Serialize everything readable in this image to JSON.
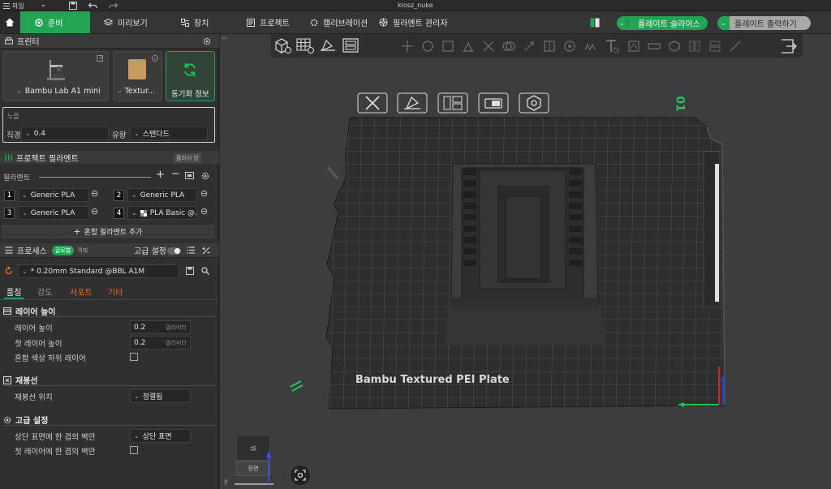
{
  "titlebar": {
    "file_menu": "파일",
    "title": "klosz_nuke"
  },
  "tabs": {
    "prepare": "준비",
    "preview": "미리보기",
    "device": "장치",
    "project": "프로젝트",
    "calibration": "캘리브레이션",
    "filament_manager": "필라멘트 관리자"
  },
  "actions": {
    "slice_plate": "플레이트 슬라이스",
    "print_plate": "플레이트 출력하기"
  },
  "printer": {
    "section_title": "프린터",
    "printer_name": "Bambu Lab A1 mini",
    "plate_name": "Textur...",
    "sync_label": "동기화 정보"
  },
  "nozzle": {
    "title": "노즐",
    "diameter_label": "직경",
    "diameter_value": "0.4",
    "flow_label": "유량",
    "flow_value": "스탠다드"
  },
  "project_filament": {
    "title": "프로젝트 필라멘트",
    "flush_badge": "플러시 양",
    "filament_label": "필라멘트",
    "slots": [
      {
        "num": "1",
        "name": "Generic PLA",
        "color": "#e8e8e8"
      },
      {
        "num": "2",
        "name": "Generic PLA",
        "color": "#e8e8e8"
      },
      {
        "num": "3",
        "name": "Generic PLA",
        "color": "#e8e8e8"
      },
      {
        "num": "4",
        "name": "PLA Basic @...",
        "color": "#e8e8e8"
      }
    ],
    "add_mixed": "혼합 필라멘트 추가"
  },
  "process": {
    "title": "프로세스",
    "global_badge": "글로벌",
    "object_badge": "객체",
    "advanced_label": "고급 설정",
    "profile": "* 0.20mm Standard @BBL A1M",
    "subtabs": [
      "품질",
      "강도",
      "서포트",
      "기타"
    ]
  },
  "quality": {
    "layer_height_group": "레이어 높이",
    "layer_height_label": "레이어 높이",
    "layer_height_value": "0.2",
    "layer_height_unit": "밀리미터",
    "first_layer_label": "첫 레이어 높이",
    "first_layer_value": "0.2",
    "first_layer_unit": "밀리미터",
    "mixed_color_label": "혼합 색상 하위 레이어",
    "seam_group": "재봉선",
    "seam_position_label": "재봉선 위치",
    "seam_position_value": "정렬됨",
    "advanced_group": "고급 설정",
    "top_single_wall_label": "상단 표면에 한 겹의 벽만",
    "top_single_wall_value": "상단 표면",
    "first_single_wall_label": "첫 레이어에 한 겹의 벽만"
  },
  "viewport": {
    "plate_label": "Bambu Textured PEI Plate",
    "plate_number": "01",
    "cube_top": "위",
    "cube_front": "전면",
    "axis_y": "y"
  },
  "colors": {
    "accent": "#21a453",
    "sidebar": "#303030",
    "viewport": "#3d3d40"
  }
}
